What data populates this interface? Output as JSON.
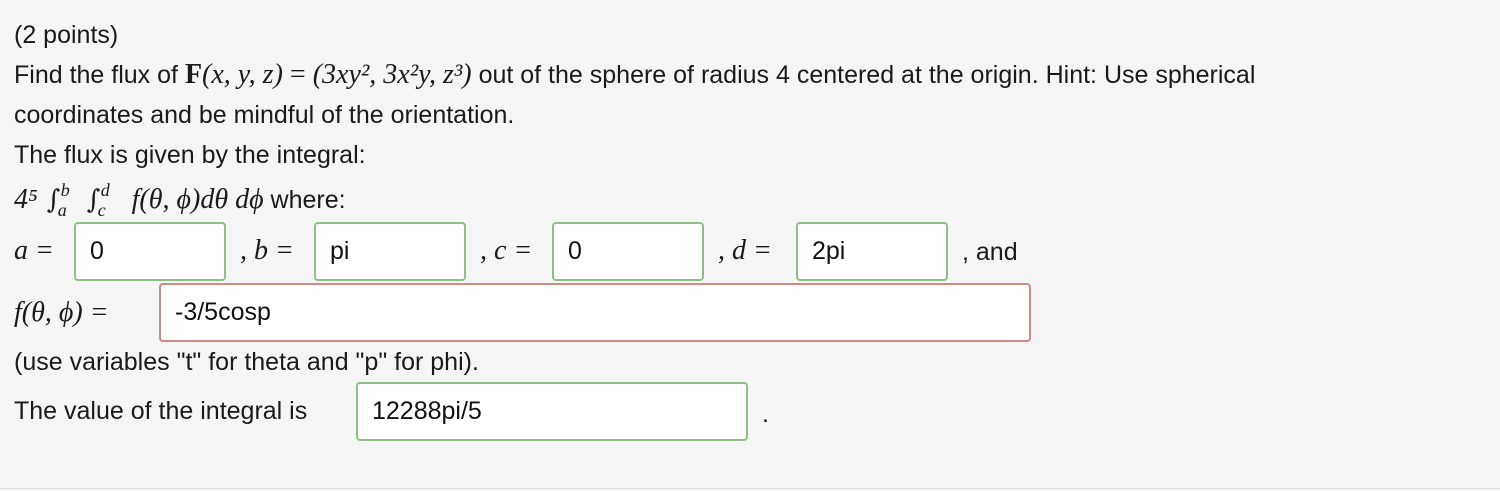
{
  "problem": {
    "points": "(2 points)",
    "statement_prefix": "Find the flux of",
    "field_name": "F",
    "field_args": "(x, y, z)",
    "equals": "=",
    "field_vector": "(3xy², 3x²y, z³)",
    "statement_suffix": "out of the sphere of radius 4 centered at the origin. Hint: Use spherical",
    "statement_line2": "coordinates and be mindful of the orientation.",
    "flux_intro": "The flux is given by the integral:",
    "integral_coeff": "4⁵",
    "integral_outer_upper": "b",
    "integral_outer_lower": "a",
    "integral_inner_upper": "d",
    "integral_inner_lower": "c",
    "integrand": "f(θ, ϕ)dθ dϕ",
    "where": "where:",
    "labels": {
      "a": "a =",
      "b": ", b =",
      "c": ", c =",
      "d": ", d =",
      "and": ", and",
      "f": "f(θ, ϕ) ="
    },
    "answers": {
      "a": "0",
      "b": "pi",
      "c": "0",
      "d": "2pi",
      "f": "-3/5cosp",
      "value": "12288pi/5"
    },
    "variables_hint": "(use variables \"t\" for theta and \"p\" for phi).",
    "value_label": "The value of the integral is",
    "value_end": "."
  },
  "colors": {
    "background": "#f5f5f5",
    "correct_border": "#8fbf86",
    "incorrect_border": "#cf8a86"
  }
}
